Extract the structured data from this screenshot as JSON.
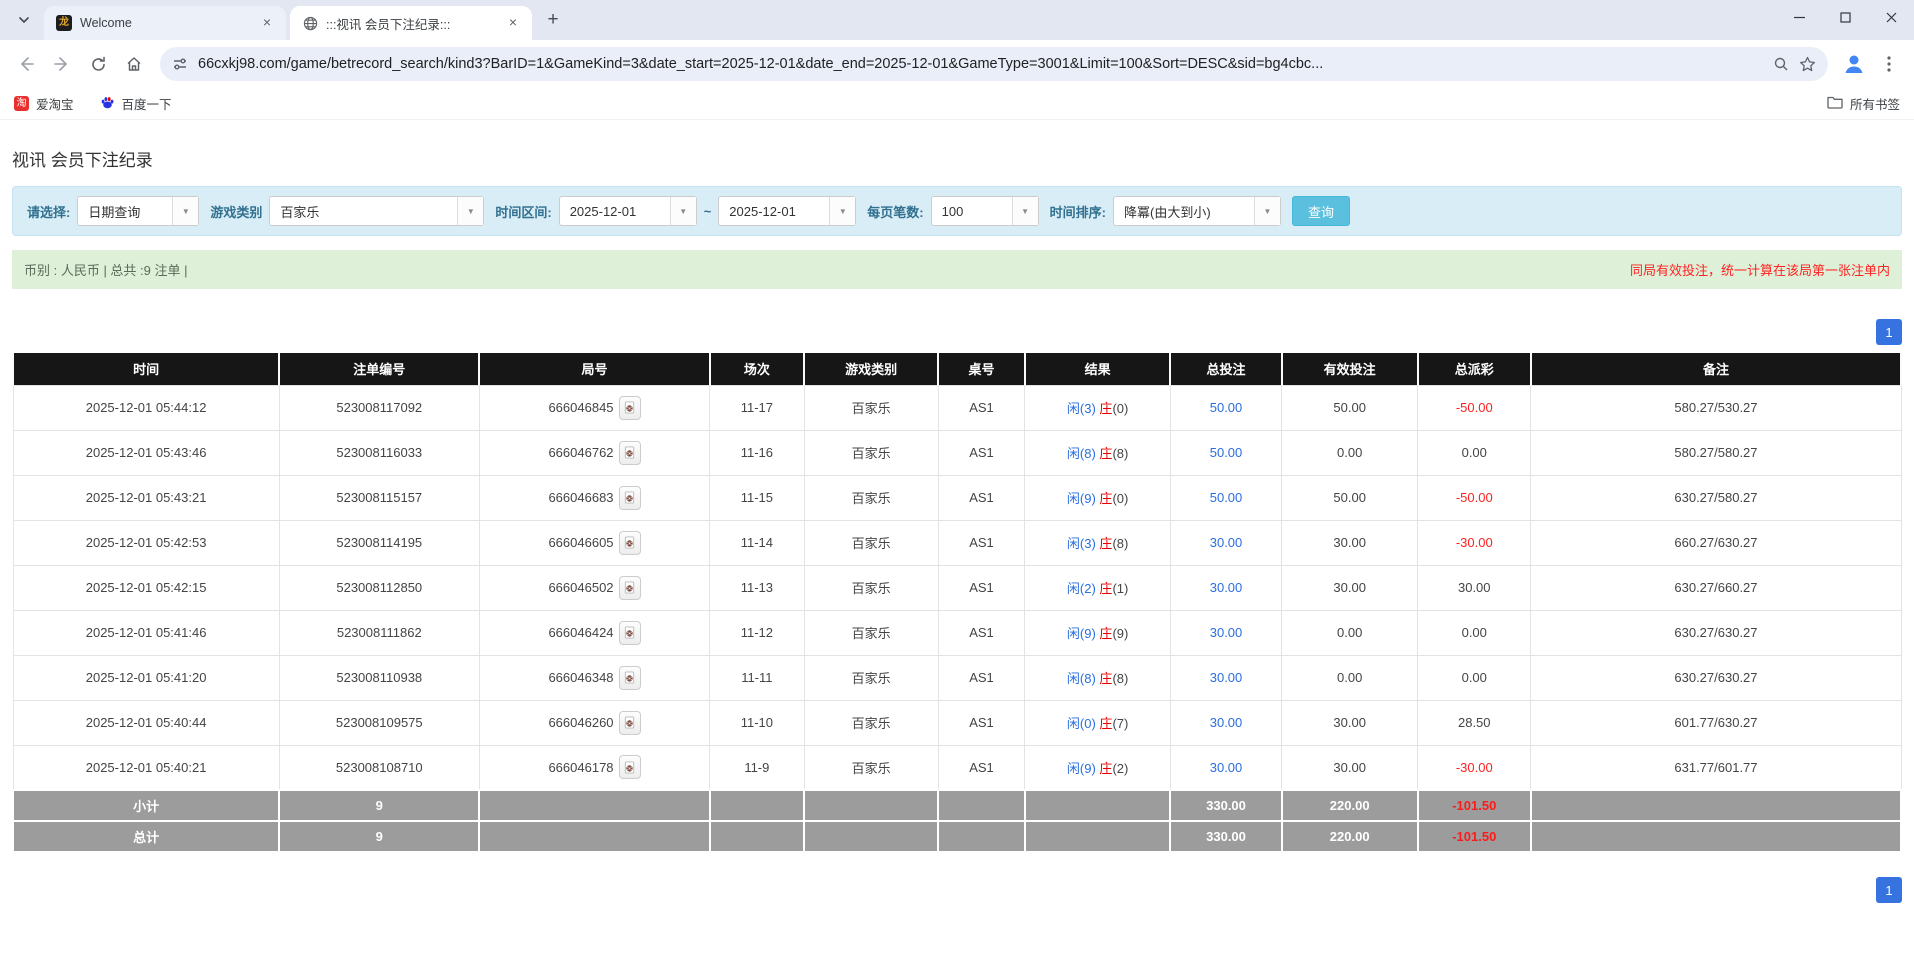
{
  "browser": {
    "tabs": [
      {
        "title": "Welcome"
      },
      {
        "title": ":::视讯 会员下注纪录:::"
      }
    ],
    "url": "66cxkj98.com/game/betrecord_search/kind3?BarID=1&GameKind=3&date_start=2025-12-01&date_end=2025-12-01&GameType=3001&Limit=100&Sort=DESC&sid=bg4cbc...",
    "bookmarks": [
      {
        "label": "爱淘宝"
      },
      {
        "label": "百度一下"
      }
    ],
    "all_bookmarks_label": "所有书签"
  },
  "page": {
    "title": "视讯 会员下注纪录",
    "filters": {
      "select_label": "请选择:",
      "select_value": "日期查询",
      "game_category_label": "游戏类别",
      "game_category_value": "百家乐",
      "date_range_label": "时间区间:",
      "date_start": "2025-12-01",
      "date_separator": "~",
      "date_end": "2025-12-01",
      "page_size_label": "每页笔数:",
      "page_size_value": "100",
      "sort_label": "时间排序:",
      "sort_value": "降冪(由大到小)",
      "search_button": "查询"
    },
    "summary": {
      "left": "币别 : 人民币 | 总共 :9 注单 |",
      "right": "同局有效投注，统一计算在该局第一张注单内"
    },
    "pagination": "1",
    "table": {
      "headers": [
        "时间",
        "注单编号",
        "局号",
        "场次",
        "游戏类别",
        "桌号",
        "结果",
        "总投注",
        "有效投注",
        "总派彩",
        "备注"
      ],
      "rows": [
        {
          "time": "2025-12-01 05:44:12",
          "bet_id": "523008117092",
          "round": "666046845",
          "session": "11-17",
          "game": "百家乐",
          "table_no": "AS1",
          "result": {
            "player_label": "闲",
            "player_num": "(3)",
            "banker_label": "庄",
            "banker_num": "(0)"
          },
          "total_bet": "50.00",
          "valid_bet": "50.00",
          "payout": "-50.00",
          "remark": "580.27/530.27"
        },
        {
          "time": "2025-12-01 05:43:46",
          "bet_id": "523008116033",
          "round": "666046762",
          "session": "11-16",
          "game": "百家乐",
          "table_no": "AS1",
          "result": {
            "player_label": "闲",
            "player_num": "(8)",
            "banker_label": "庄",
            "banker_num": "(8)"
          },
          "total_bet": "50.00",
          "valid_bet": "0.00",
          "payout": "0.00",
          "remark": "580.27/580.27"
        },
        {
          "time": "2025-12-01 05:43:21",
          "bet_id": "523008115157",
          "round": "666046683",
          "session": "11-15",
          "game": "百家乐",
          "table_no": "AS1",
          "result": {
            "player_label": "闲",
            "player_num": "(9)",
            "banker_label": "庄",
            "banker_num": "(0)"
          },
          "total_bet": "50.00",
          "valid_bet": "50.00",
          "payout": "-50.00",
          "remark": "630.27/580.27"
        },
        {
          "time": "2025-12-01 05:42:53",
          "bet_id": "523008114195",
          "round": "666046605",
          "session": "11-14",
          "game": "百家乐",
          "table_no": "AS1",
          "result": {
            "player_label": "闲",
            "player_num": "(3)",
            "banker_label": "庄",
            "banker_num": "(8)"
          },
          "total_bet": "30.00",
          "valid_bet": "30.00",
          "payout": "-30.00",
          "remark": "660.27/630.27"
        },
        {
          "time": "2025-12-01 05:42:15",
          "bet_id": "523008112850",
          "round": "666046502",
          "session": "11-13",
          "game": "百家乐",
          "table_no": "AS1",
          "result": {
            "player_label": "闲",
            "player_num": "(2)",
            "banker_label": "庄",
            "banker_num": "(1)"
          },
          "total_bet": "30.00",
          "valid_bet": "30.00",
          "payout": "30.00",
          "remark": "630.27/660.27"
        },
        {
          "time": "2025-12-01 05:41:46",
          "bet_id": "523008111862",
          "round": "666046424",
          "session": "11-12",
          "game": "百家乐",
          "table_no": "AS1",
          "result": {
            "player_label": "闲",
            "player_num": "(9)",
            "banker_label": "庄",
            "banker_num": "(9)"
          },
          "total_bet": "30.00",
          "valid_bet": "0.00",
          "payout": "0.00",
          "remark": "630.27/630.27"
        },
        {
          "time": "2025-12-01 05:41:20",
          "bet_id": "523008110938",
          "round": "666046348",
          "session": "11-11",
          "game": "百家乐",
          "table_no": "AS1",
          "result": {
            "player_label": "闲",
            "player_num": "(8)",
            "banker_label": "庄",
            "banker_num": "(8)"
          },
          "total_bet": "30.00",
          "valid_bet": "0.00",
          "payout": "0.00",
          "remark": "630.27/630.27"
        },
        {
          "time": "2025-12-01 05:40:44",
          "bet_id": "523008109575",
          "round": "666046260",
          "session": "11-10",
          "game": "百家乐",
          "table_no": "AS1",
          "result": {
            "player_label": "闲",
            "player_num": "(0)",
            "banker_label": "庄",
            "banker_num": "(7)"
          },
          "total_bet": "30.00",
          "valid_bet": "30.00",
          "payout": "28.50",
          "remark": "601.77/630.27"
        },
        {
          "time": "2025-12-01 05:40:21",
          "bet_id": "523008108710",
          "round": "666046178",
          "session": "11-9",
          "game": "百家乐",
          "table_no": "AS1",
          "result": {
            "player_label": "闲",
            "player_num": "(9)",
            "banker_label": "庄",
            "banker_num": "(2)"
          },
          "total_bet": "30.00",
          "valid_bet": "30.00",
          "payout": "-30.00",
          "remark": "631.77/601.77"
        }
      ],
      "subtotal": {
        "label": "小计",
        "count": "9",
        "total_bet": "330.00",
        "valid_bet": "220.00",
        "payout": "-101.50"
      },
      "total": {
        "label": "总计",
        "count": "9",
        "total_bet": "330.00",
        "valid_bet": "220.00",
        "payout": "-101.50"
      }
    }
  },
  "colors": {
    "bet_blue": "#2a6ee0",
    "negative_red": "#ff2222",
    "banker_red": "#e60000",
    "pagination_blue": "#3672e0",
    "filter_bg": "#d9edf7",
    "summary_bg": "#dff0d8",
    "header_bg": "#161616",
    "footer_bg": "#9c9c9c",
    "search_btn": "#5bc0de"
  }
}
